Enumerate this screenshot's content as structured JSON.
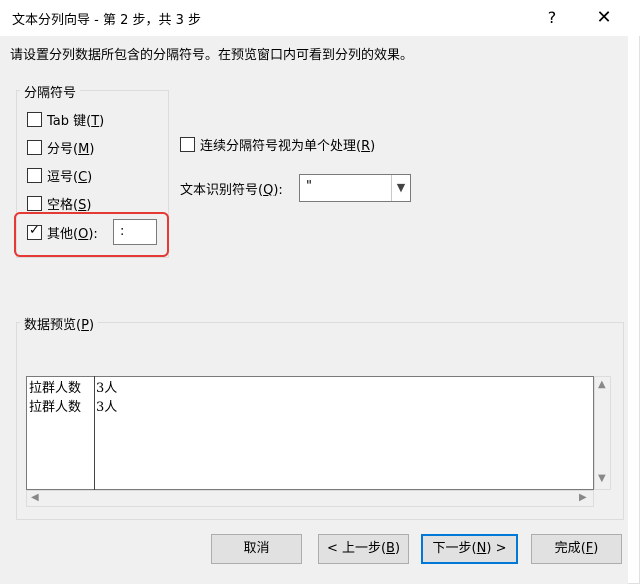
{
  "window": {
    "title": "文本分列向导 - 第 2 步，共 3 步",
    "help_glyph": "?",
    "close_glyph": "✕"
  },
  "instruction": "请设置分列数据所包含的分隔符号。在预览窗口内可看到分列的效果。",
  "delimiters": {
    "group_label": "分隔符号",
    "tab": {
      "label": "Tab 键",
      "key": "T",
      "checked": false
    },
    "semicolon": {
      "label": "分号",
      "key": "M",
      "checked": false
    },
    "comma": {
      "label": "逗号",
      "key": "C",
      "checked": false
    },
    "space": {
      "label": "空格",
      "key": "S",
      "checked": false
    },
    "other": {
      "label": "其他",
      "key": "O",
      "checked": true,
      "value": ":"
    }
  },
  "consecutive": {
    "label": "连续分隔符号视为单个处理",
    "key": "R",
    "checked": false
  },
  "text_qualifier": {
    "label": "文本识别符号",
    "key": "Q",
    "value": "\""
  },
  "preview": {
    "label": "数据预览",
    "key": "P",
    "rows": [
      [
        "拉群人数",
        "3人"
      ],
      [
        "拉群人数",
        "3人"
      ]
    ]
  },
  "buttons": {
    "cancel": "取消",
    "back": "< 上一步",
    "back_key": "B",
    "next": "下一步",
    "next_key": "N",
    "next_suffix": " >",
    "finish": "完成",
    "finish_key": "F"
  }
}
